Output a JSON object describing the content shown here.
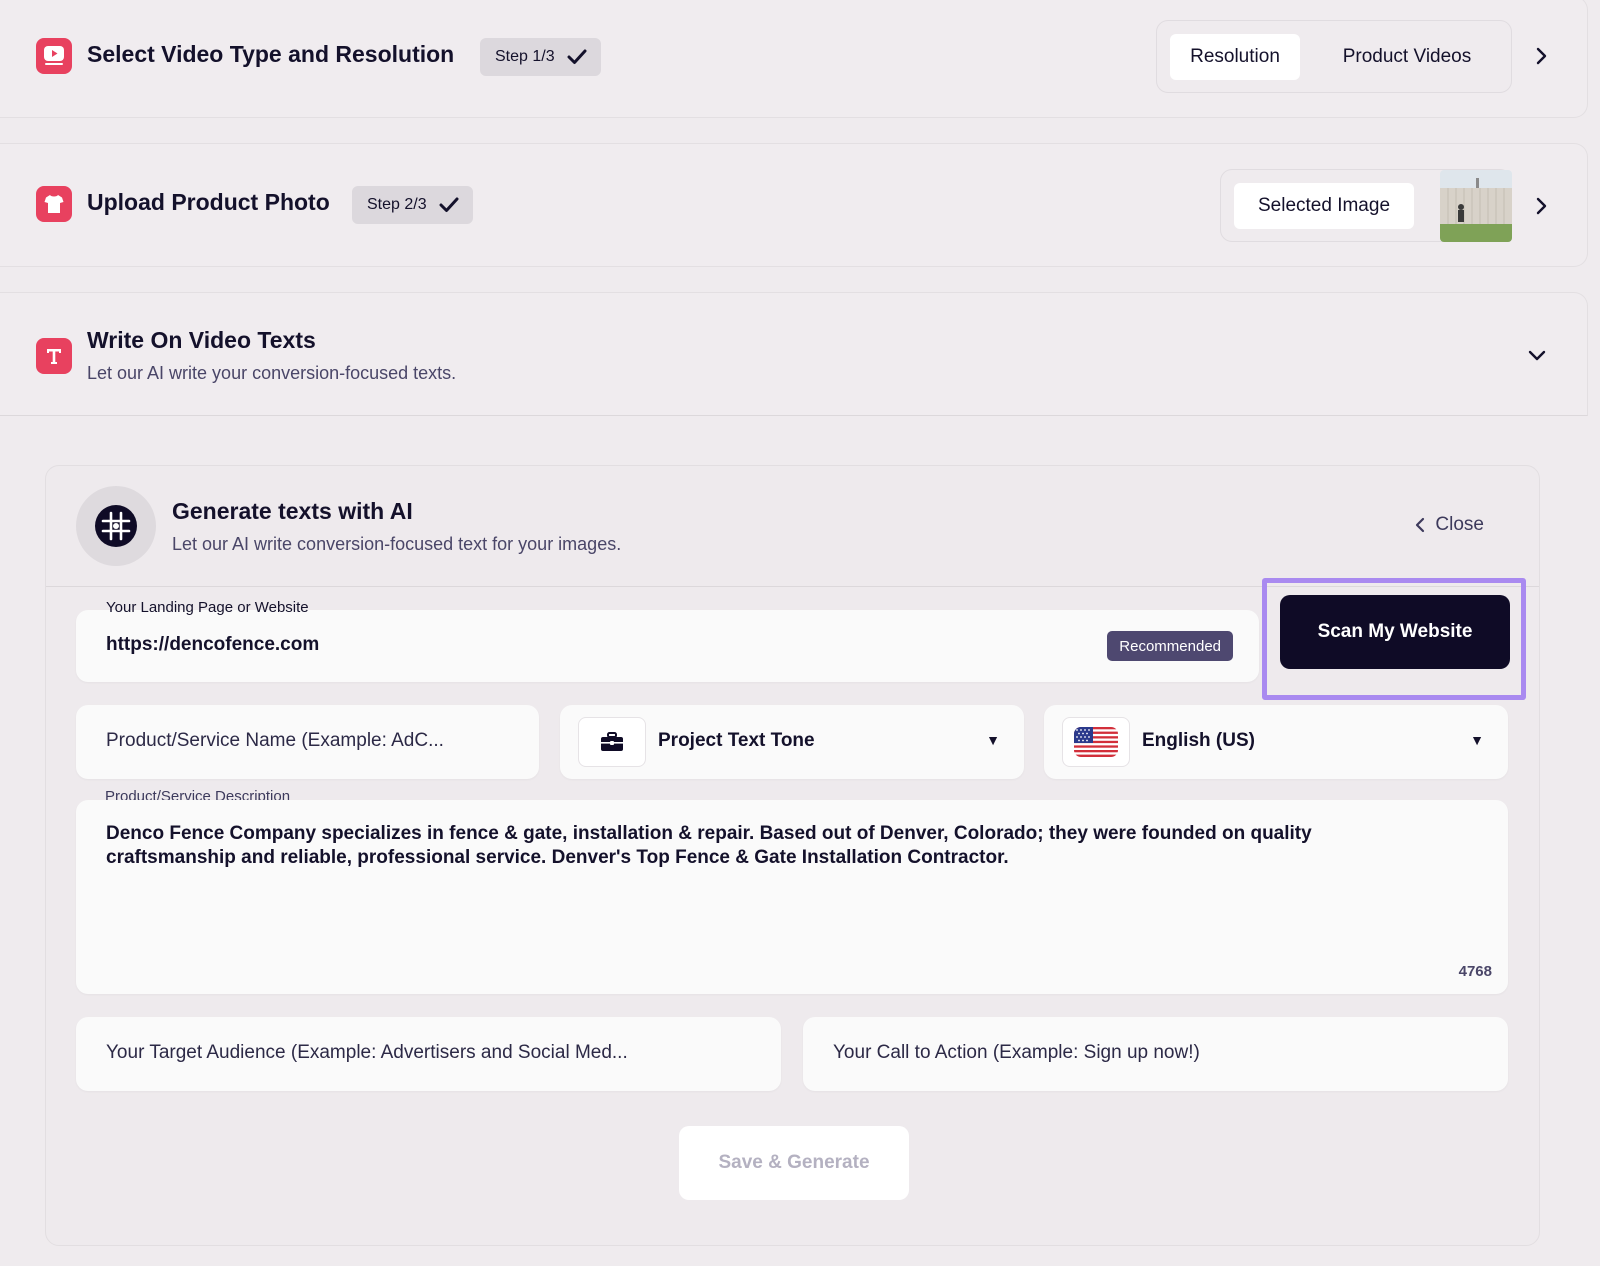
{
  "steps": [
    {
      "title": "Select Video Type and Resolution",
      "badge": "Step 1/3",
      "icon": "video-play-icon",
      "options": [
        "Resolution",
        "Product Videos"
      ],
      "active_option": "Resolution"
    },
    {
      "title": "Upload Product Photo",
      "badge": "Step 2/3",
      "icon": "shirt-icon",
      "selected_label": "Selected Image"
    },
    {
      "title": "Write On Video Texts",
      "subtitle": "Let our AI write your conversion-focused texts.",
      "icon": "text-t-icon"
    }
  ],
  "ai": {
    "title": "Generate texts with AI",
    "subtitle": "Let our AI write conversion-focused text for your images.",
    "close_label": "Close",
    "icon": "brain-icon"
  },
  "form": {
    "website_label": "Your Landing Page or Website",
    "website_value": "https://dencofence.com",
    "recommended": "Recommended",
    "scan_button": "Scan My Website",
    "product_name_placeholder": "Product/Service Name (Example: AdC...",
    "tone_label": "Project Text Tone",
    "language_label": "English (US)",
    "description_label": "Product/Service Description",
    "description_value": "Denco Fence Company specializes in fence & gate, installation & repair. Based out of Denver, Colorado; they were founded on quality craftsmanship and reliable, professional service. Denver's Top Fence & Gate Installation Contractor.",
    "char_count": "4768",
    "audience_placeholder": "Your Target Audience (Example: Advertisers and Social Med...",
    "cta_placeholder": "Your Call to Action (Example: Sign up now!)",
    "save_button": "Save & Generate"
  },
  "colors": {
    "accent_pink": "#e8415f",
    "dark_button": "#0f0b26",
    "highlight_purple": "#a98af0",
    "badge_purple": "#4e4870"
  }
}
